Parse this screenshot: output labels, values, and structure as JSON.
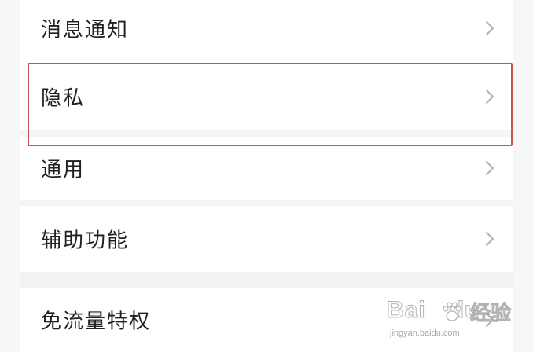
{
  "settings_items": [
    {
      "label": "消息通知"
    },
    {
      "label": "隐私"
    },
    {
      "label": "通用"
    },
    {
      "label": "辅助功能"
    },
    {
      "label": "免流量特权"
    }
  ],
  "chevron_icon": "chevron-right-icon",
  "highlight_color": "#c9524f",
  "watermark": {
    "brand": "Bai",
    "brand2": "du",
    "suffix": "经验",
    "url": "jingyan.baidu.com"
  }
}
